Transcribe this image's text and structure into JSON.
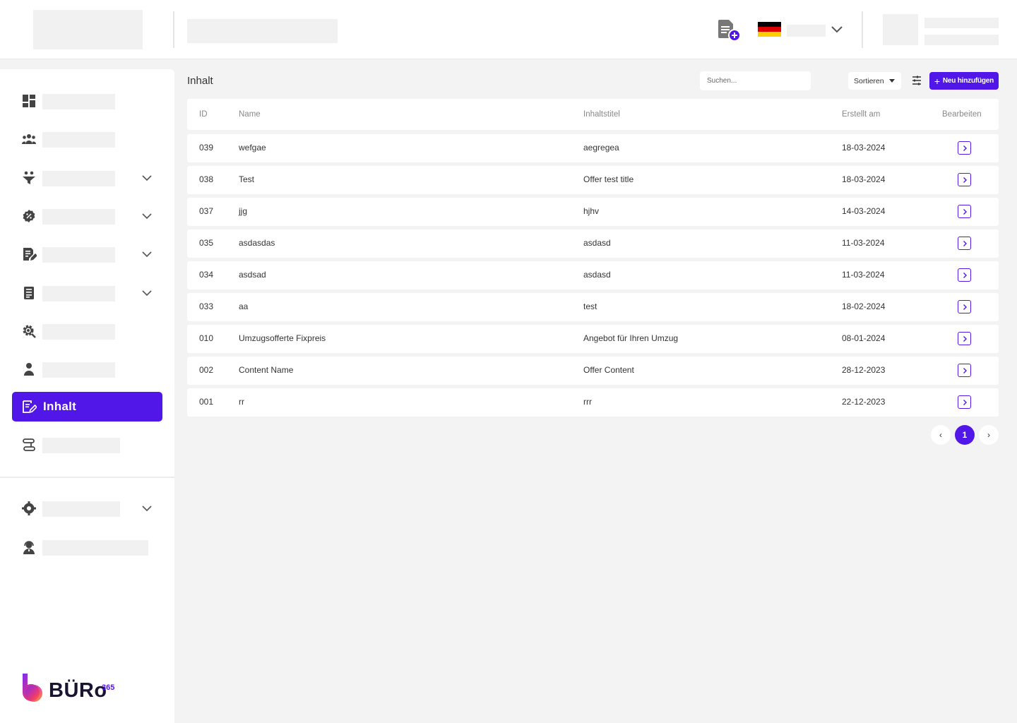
{
  "colors": {
    "accent": "#5116e8",
    "background": "#f3f3f3",
    "surface": "#ffffff"
  },
  "header": {
    "new_document_icon": "document-add-icon",
    "language_flag": "flag-germany-icon",
    "language_chevron": "chevron-down-icon"
  },
  "sidebar": {
    "items": [
      {
        "icon": "dashboard-icon",
        "has_submenu": false
      },
      {
        "icon": "users-group-icon",
        "has_submenu": false
      },
      {
        "icon": "funnel-people-icon",
        "has_submenu": true
      },
      {
        "icon": "discount-badge-icon",
        "has_submenu": true
      },
      {
        "icon": "document-edit-icon",
        "has_submenu": true
      },
      {
        "icon": "invoice-icon",
        "has_submenu": true
      },
      {
        "icon": "gear-search-icon",
        "has_submenu": false
      },
      {
        "icon": "user-icon",
        "has_submenu": false
      },
      {
        "icon": "document-edit-icon",
        "label": "Inhalt",
        "active": true
      },
      {
        "icon": "route-icon",
        "has_submenu": false
      }
    ],
    "bottom_items": [
      {
        "icon": "settings-gear-icon",
        "has_submenu": true
      },
      {
        "icon": "support-agent-icon",
        "has_submenu": false
      }
    ],
    "brand": {
      "name": "BÜRo",
      "superscript": "365"
    }
  },
  "main": {
    "title": "Inhalt",
    "search_placeholder": "Suchen...",
    "sort_label": "Sortieren",
    "add_label": "Neu hinzufügen",
    "columns": [
      "ID",
      "Name",
      "Inhaltstitel",
      "Erstellt am",
      "Bearbeiten"
    ],
    "rows": [
      {
        "id": "039",
        "name": "wefgae",
        "title": "aegregea",
        "date": "18-03-2024"
      },
      {
        "id": "038",
        "name": "Test",
        "title": "Offer test title",
        "date": "18-03-2024"
      },
      {
        "id": "037",
        "name": "jjg",
        "title": "hjhv",
        "date": "14-03-2024"
      },
      {
        "id": "035",
        "name": "asdasdas",
        "title": "asdasd",
        "date": "11-03-2024"
      },
      {
        "id": "034",
        "name": "asdsad",
        "title": "asdasd",
        "date": "11-03-2024"
      },
      {
        "id": "033",
        "name": "aa",
        "title": "test",
        "date": "18-02-2024"
      },
      {
        "id": "010",
        "name": "Umzugsofferte Fixpreis",
        "title": "Angebot für Ihren Umzug",
        "date": "08-01-2024"
      },
      {
        "id": "002",
        "name": "Content Name",
        "title": "Offer Content",
        "date": "28-12-2023"
      },
      {
        "id": "001",
        "name": "rr",
        "title": "rrr",
        "date": "22-12-2023"
      }
    ],
    "pagination": {
      "prev": "‹",
      "current": "1",
      "next": "›"
    }
  }
}
